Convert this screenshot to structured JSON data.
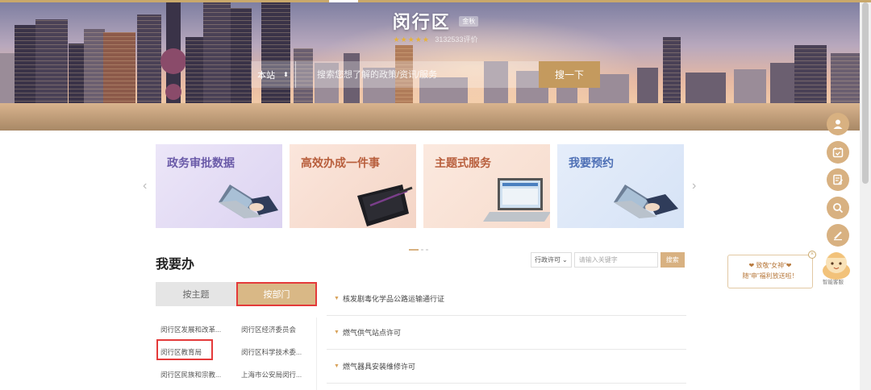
{
  "banner": {
    "district_name": "闵行区",
    "district_tag": "金秋",
    "rating_stars": "★★★★★",
    "rating_count": "3132533评价"
  },
  "search": {
    "scope_label": "本站",
    "scope_arrow": "⬍",
    "placeholder": "搜索您想了解的政策/资讯/服务",
    "button_label": "搜一下"
  },
  "feature_cards": [
    {
      "title": "政务审批数据",
      "icon": "laptop-hands-icon"
    },
    {
      "title": "高效办成一件事",
      "icon": "tablet-pen-icon"
    },
    {
      "title": "主题式服务",
      "icon": "laptop-screen-icon"
    },
    {
      "title": "我要预约",
      "icon": "laptop-hands-icon"
    }
  ],
  "carousel": {
    "prev": "‹",
    "next": "›"
  },
  "section": {
    "title": "我要办",
    "filter_select": "行政许可",
    "filter_arrow": "⌄",
    "keyword_placeholder": "请输入关键字",
    "filter_button": "搜索"
  },
  "tabs": {
    "by_theme": "按主题",
    "by_department": "按部门"
  },
  "departments": [
    [
      "闵行区发展和改革...",
      "闵行区经济委员会"
    ],
    [
      "闵行区教育局",
      "闵行区科学技术委..."
    ],
    [
      "闵行区民族和宗教...",
      "上海市公安局闵行..."
    ]
  ],
  "service_items": [
    "核发剧毒化学品公路运输通行证",
    "燃气供气站点许可",
    "燃气器具安装维修许可"
  ],
  "item_caret": "▼",
  "float_buttons": [
    "user-icon",
    "calendar-icon",
    "edit-doc-icon",
    "search-icon",
    "pen-icon"
  ],
  "promo": {
    "line1": "❤ 致敬“女神”❤",
    "line2": "随“申”福利放送啦！",
    "close": "×",
    "mascot_label": "智能客服"
  },
  "colors": {
    "accent": "#d8b181",
    "highlight_border": "#e43a3a"
  }
}
